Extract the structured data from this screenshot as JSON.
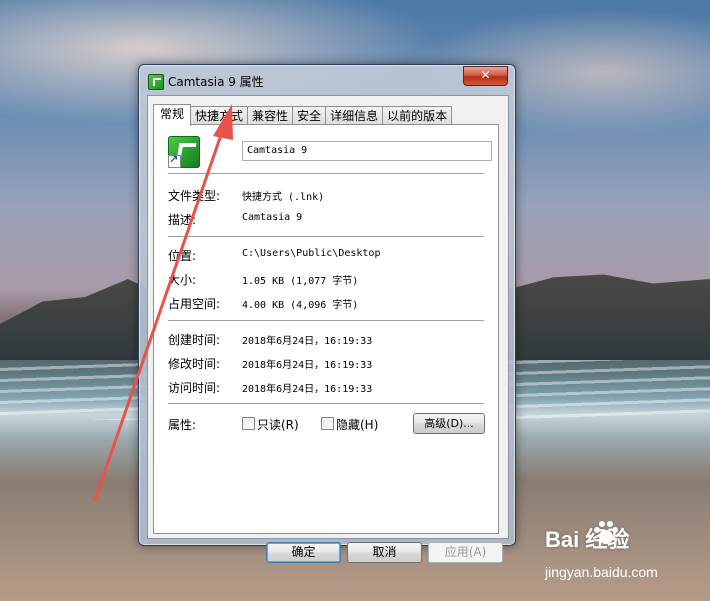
{
  "window": {
    "title": "Camtasia 9 属性",
    "close_glyph": "✕"
  },
  "tabs": [
    {
      "label": "常规",
      "active": true
    },
    {
      "label": "快捷方式"
    },
    {
      "label": "兼容性"
    },
    {
      "label": "安全"
    },
    {
      "label": "详细信息"
    },
    {
      "label": "以前的版本"
    }
  ],
  "general": {
    "icon": "camtasia-shortcut-icon",
    "name_value": "Camtasia 9",
    "rows": [
      {
        "label": "文件类型:",
        "value": "快捷方式 (.lnk)"
      },
      {
        "label": "描述:",
        "value": "Camtasia 9"
      },
      {
        "label": "位置:",
        "value": "C:\\Users\\Public\\Desktop"
      },
      {
        "label": "大小:",
        "value": "1.05 KB (1,077 字节)"
      },
      {
        "label": "占用空间:",
        "value": "4.00 KB (4,096 字节)"
      },
      {
        "label": "创建时间:",
        "value": "2018年6月24日，16:19:33"
      },
      {
        "label": "修改时间:",
        "value": "2018年6月24日，16:19:33"
      },
      {
        "label": "访问时间:",
        "value": "2018年6月24日，16:19:33"
      }
    ],
    "attributes_label": "属性:",
    "readonly_label": "只读(R)",
    "readonly_checked": false,
    "hidden_label": "隐藏(H)",
    "hidden_checked": false,
    "advanced_label": "高级(D)..."
  },
  "buttons": {
    "ok": "确定",
    "cancel": "取消",
    "apply": "应用(A)"
  },
  "watermark": {
    "logo": "Bai 经验",
    "url": "jingyan.baidu.com"
  },
  "colors": {
    "arrow": "#e8524a",
    "close_button": "#c7442c"
  }
}
